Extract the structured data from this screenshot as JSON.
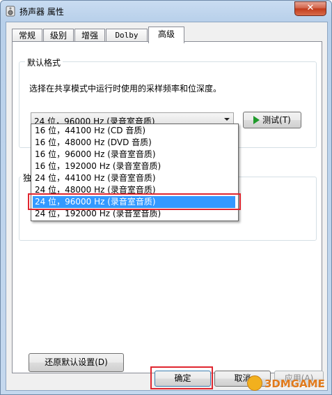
{
  "window": {
    "title": "扬声器 属性",
    "close_label": "✕"
  },
  "tabs": [
    {
      "label": "常规",
      "active": false
    },
    {
      "label": "级别",
      "active": false
    },
    {
      "label": "增强",
      "active": false
    },
    {
      "label": "Dolby",
      "active": false
    },
    {
      "label": "高级",
      "active": true
    }
  ],
  "default_format": {
    "group_label": "默认格式",
    "description": "选择在共享模式中运行时使用的采样频率和位深度。",
    "selected_value": "24 位，96000 Hz (录音室音质)",
    "test_button": "测试(T)",
    "options": [
      "16 位，44100 Hz (CD 音质)",
      "16 位，48000 Hz (DVD 音质)",
      "16 位，96000 Hz (录音室音质)",
      "16 位，192000 Hz (录音室音质)",
      "24 位，44100 Hz (录音室音质)",
      "24 位，48000 Hz (录音室音质)",
      "24 位，96000 Hz (录音室音质)",
      "24 位，192000 Hz (录音室音质)"
    ],
    "highlighted_index": 6
  },
  "exclusive_group": {
    "label_partial": "独"
  },
  "restore_button": "还原默认设置(D)",
  "footer": {
    "ok": "确定",
    "cancel": "取消",
    "apply": "应用(A)"
  },
  "watermark": {
    "text": "3DMGAME"
  },
  "colors": {
    "selection": "#3399ff",
    "annotation_red": "#e0262f",
    "play_green": "#1f9a2b"
  }
}
